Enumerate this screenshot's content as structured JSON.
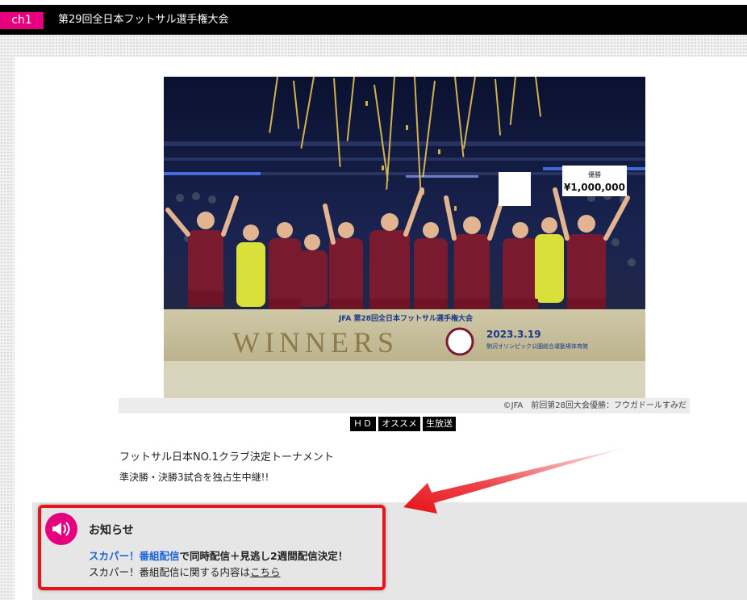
{
  "header": {
    "channel": "ch1",
    "title": "第29回全日本フットサル選手権大会"
  },
  "photo": {
    "banner_brand": "JFA 第28回全日本フットサル選手権大会",
    "banner_text": "WINNERS",
    "banner_date": "2023.3.19",
    "banner_venue": "駒沢オリンピック公園総合運動場体育館",
    "prize_label": "優勝",
    "prize_amount": "¥1,000,000",
    "caption": "©JFA　前回第28回大会優勝：フウガドールすみだ"
  },
  "tags": [
    "ＨＤ",
    "オススメ",
    "生放送"
  ],
  "description": {
    "line1": "フットサル日本NO.1クラブ決定トーナメント",
    "line2": "準決勝・決勝3試合を独占生中継!!"
  },
  "notice": {
    "icon": "speaker-icon",
    "title": "お知らせ",
    "line1_link": "スカパー！番組配信",
    "line1_rest": "で同時配信＋見逃し2週間配信決定！",
    "line2_text": "スカパー！番組配信に関する内容は",
    "line2_link": "こちら"
  },
  "colors": {
    "accent": "#e6007e",
    "link": "#1a66d6",
    "highlight": "#e8141b",
    "header_bg": "#000000"
  }
}
